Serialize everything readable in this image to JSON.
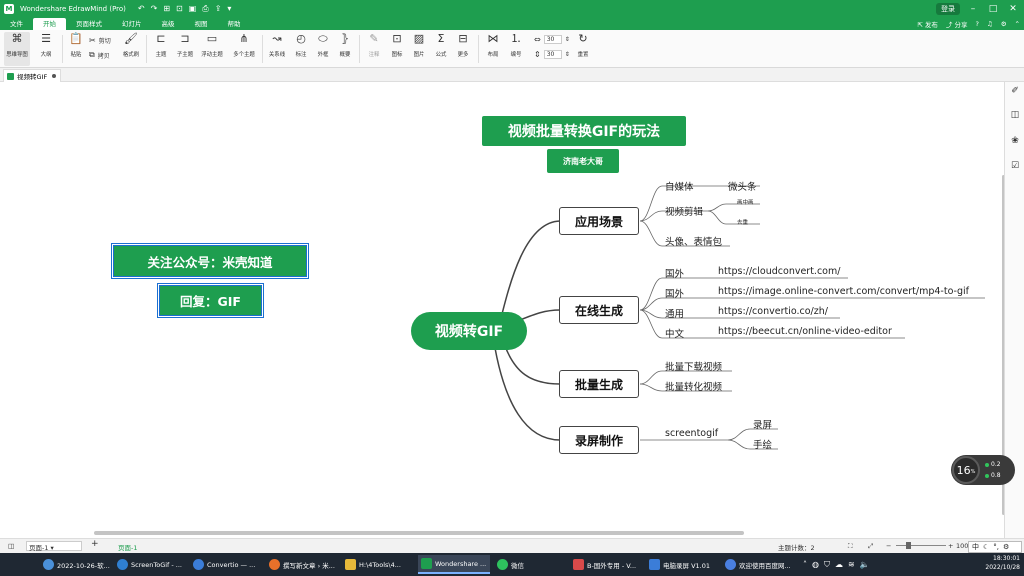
{
  "window": {
    "app_title": "Wondershare EdrawMind (Pro)",
    "login_label": "登录",
    "logo_letter": "M"
  },
  "menubar": {
    "items": [
      "文件",
      "开始",
      "页面样式",
      "幻灯片",
      "高级",
      "视图",
      "帮助"
    ],
    "active": "开始",
    "publish": "发布",
    "share": "分享"
  },
  "ribbon": {
    "mindmap": "思维导图",
    "outline": "大纲",
    "paste": "粘贴",
    "cut": "剪切",
    "copy": "拷贝",
    "format_painter": "格式刷",
    "topic": "主题",
    "subtopic": "子主题",
    "floating_topic": "浮动主题",
    "multiple_topics": "多个主题",
    "relationship": "关系线",
    "callout": "标注",
    "boundary": "外框",
    "summary": "概要",
    "annotation": "注释",
    "icon": "图标",
    "image": "图片",
    "formula": "公式",
    "more": "更多",
    "layout": "布局",
    "numbering": "编号",
    "spacing_h": "30",
    "spacing_v": "30",
    "reset": "重置"
  },
  "doc": {
    "tab_name": "视频转GIF"
  },
  "mindmap": {
    "title": "视频批量转换GIF的玩法",
    "subtitle": "济南老大哥",
    "root": "视频转GIF",
    "floating": [
      "关注公众号：米壳知道",
      "回复：GIF"
    ],
    "branches": [
      {
        "label": "应用场景",
        "children": [
          {
            "label": "自媒体",
            "children": [
              "微头条"
            ]
          },
          {
            "label": "视频剪辑",
            "children": [
              "画中画",
              "去重"
            ]
          },
          {
            "label": "头像、表情包",
            "children": []
          }
        ]
      },
      {
        "label": "在线生成",
        "children": [
          {
            "label": "国外",
            "children": [
              "https://cloudconvert.com/"
            ]
          },
          {
            "label": "国外",
            "children": [
              "https://image.online-convert.com/convert/mp4-to-gif"
            ]
          },
          {
            "label": "通用",
            "children": [
              "https://convertio.co/zh/"
            ]
          },
          {
            "label": "中文",
            "children": [
              "https://beecut.cn/online-video-editor"
            ]
          }
        ]
      },
      {
        "label": "批量生成",
        "children": [
          {
            "label": "批量下载视频",
            "children": []
          },
          {
            "label": "批量转化视频",
            "children": []
          }
        ]
      },
      {
        "label": "录屏制作",
        "children": [
          {
            "label": "screentogif",
            "children": [
              "录屏",
              "手绘"
            ]
          }
        ]
      }
    ]
  },
  "statusbar": {
    "page_select": "页面-1",
    "page_tab": "页面-1",
    "topic_count_label": "主题计数：",
    "topic_count": "2",
    "zoom": "100%"
  },
  "widget": {
    "value": "16",
    "unit": "%",
    "up": "0.2",
    "down": "0.8"
  },
  "taskbar": {
    "items": [
      {
        "label": "2022-10-26-软...",
        "color": "#4a90d9"
      },
      {
        "label": "ScreenToGif - ...",
        "color": "#2f7fd1"
      },
      {
        "label": "Convertio — ...",
        "color": "#3b7dd8"
      },
      {
        "label": "撰写新文章 › 米...",
        "color": "#e8702a"
      },
      {
        "label": "H:\\4Tools\\4...",
        "color": "#e6b93a"
      },
      {
        "label": "Wondershare ...",
        "color": "#1e9e4f"
      },
      {
        "label": "微信",
        "color": "#2ec25e"
      },
      {
        "label": "B-国外专用 - V...",
        "color": "#d94a4a"
      },
      {
        "label": "电脑录屏 V1.01",
        "color": "#3b7dd8"
      },
      {
        "label": "欢迎使用百度网...",
        "color": "#4a7fe0"
      }
    ],
    "time": "18:30:01",
    "date": "2022/10/28"
  },
  "ime": {
    "lang": "中"
  }
}
